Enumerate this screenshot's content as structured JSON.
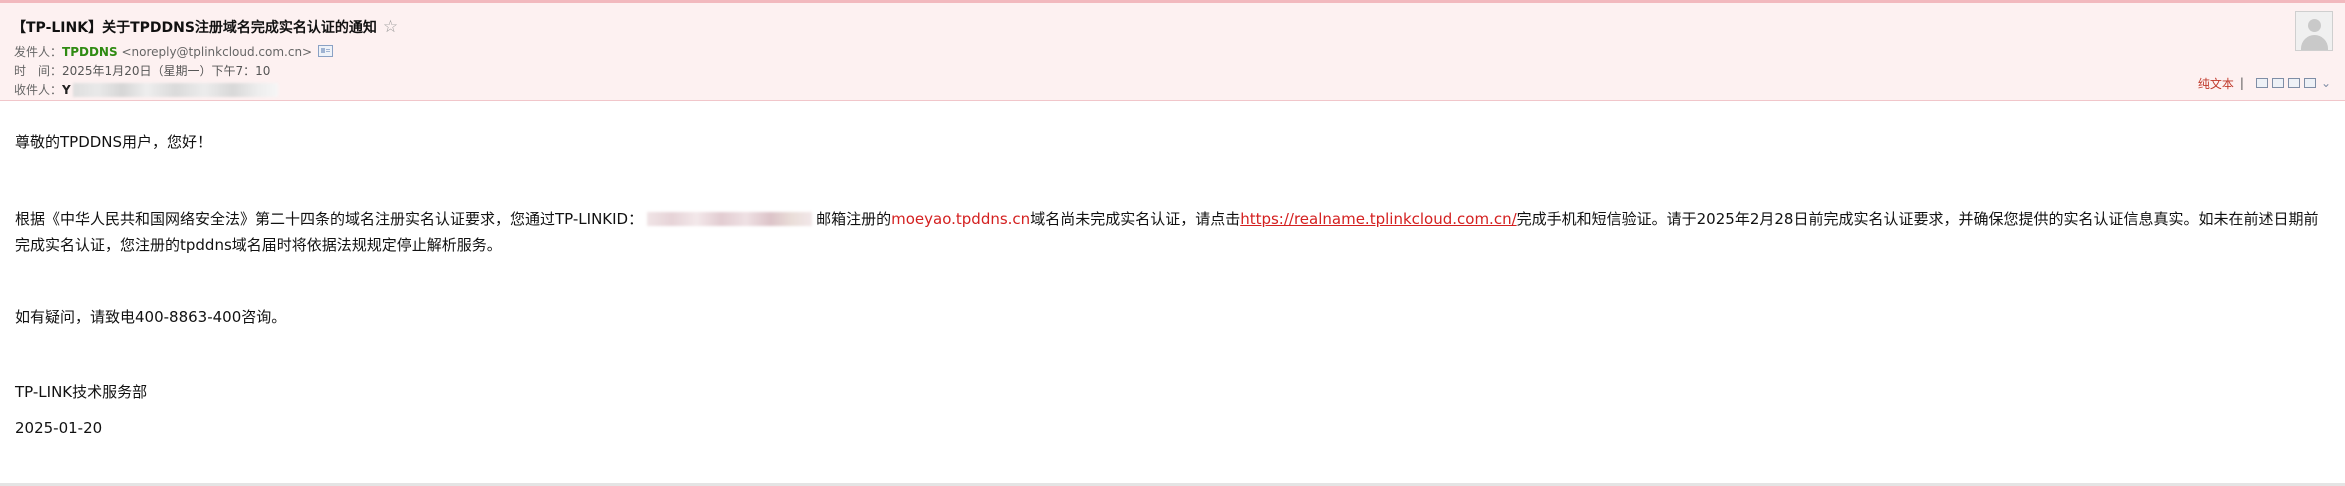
{
  "header": {
    "subject": "【TP-LINK】关于TPDDNS注册域名完成实名认证的通知",
    "star_icon": "star-icon",
    "from_label": "发件人：",
    "sender_name": "TPDDNS",
    "sender_email": "<noreply@tplinkcloud.com.cn>",
    "time_label": "时　间：",
    "time_value": "2025年1月20日（星期一）下午7：10",
    "to_label": "收件人：",
    "to_initial": "Y",
    "plain_text_label": "纯文本",
    "toolbar_separator": "|"
  },
  "body": {
    "greeting": "尊敬的TPDDNS用户，您好！",
    "para_part1": "根据《中华人民共和国网络安全法》第二十四条的域名注册实名认证要求，您通过TP-LINKID：",
    "para_part2": "邮箱注册的",
    "domain_name": "moeyao.tpddns.cn",
    "para_part3": "域名尚未完成实名认证，请点击",
    "auth_url": "https://realname.tplinkcloud.com.cn/",
    "para_part4": "完成手机和短信验证。请于2025年2月28日前完成实名认证要求，并确保您提供的实名认证信息真实。如未在前述日期前完成实名认证，您注册的tpddns域名届时将依据法规规定停止解析服务。",
    "help_text": "如有疑问，请致电400-8863-400咨询。",
    "signature": "TP-LINK技术服务部",
    "date": "2025-01-20"
  },
  "colors": {
    "header_bg": "#fdf1f1",
    "sender_green": "#2f8b12",
    "link_red": "#d42020"
  }
}
